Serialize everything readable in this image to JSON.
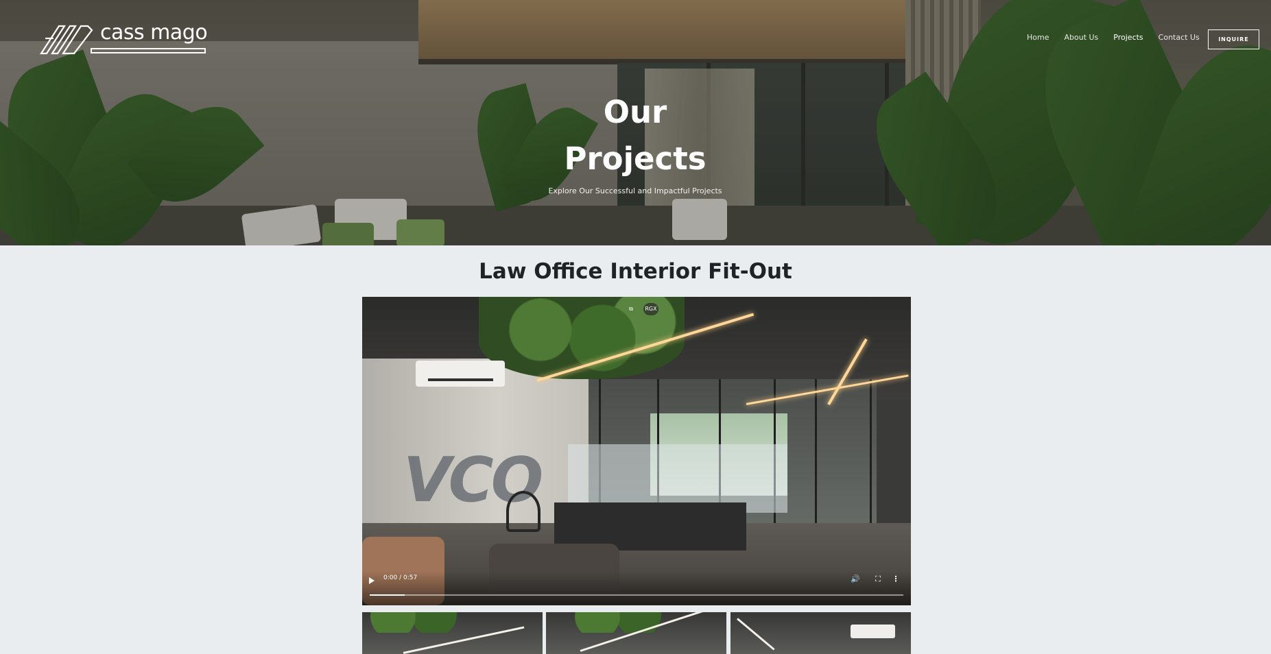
{
  "brand": {
    "name": "cass mago"
  },
  "nav": {
    "items": [
      {
        "label": "Home",
        "active": false
      },
      {
        "label": "About Us",
        "active": false
      },
      {
        "label": "Projects",
        "active": true
      },
      {
        "label": "Contact Us",
        "active": false
      }
    ],
    "cta_label": "INQUIRE"
  },
  "hero": {
    "title_line1": "Our",
    "title_line2": "Projects",
    "subtitle": "Explore Our Successful and Impactful Projects"
  },
  "project": {
    "title": "Law Office Interior Fit-Out",
    "video": {
      "current_time": "0:00",
      "duration": "0:57",
      "time_display": "0:00 / 0:57",
      "buffered_fraction": 0.065,
      "overlay_badge": "RGX",
      "scene_text": "VCO"
    },
    "thumbnail_count": 3
  },
  "colors": {
    "page_background": "#e9edf0",
    "title_text": "#1f2226",
    "nav_text": "#e7e7e2"
  },
  "icons": {
    "play": "play-icon",
    "volume": "volume-icon",
    "fullscreen": "fullscreen-icon",
    "more": "more-vertical-icon",
    "pip": "picture-in-picture-icon"
  }
}
